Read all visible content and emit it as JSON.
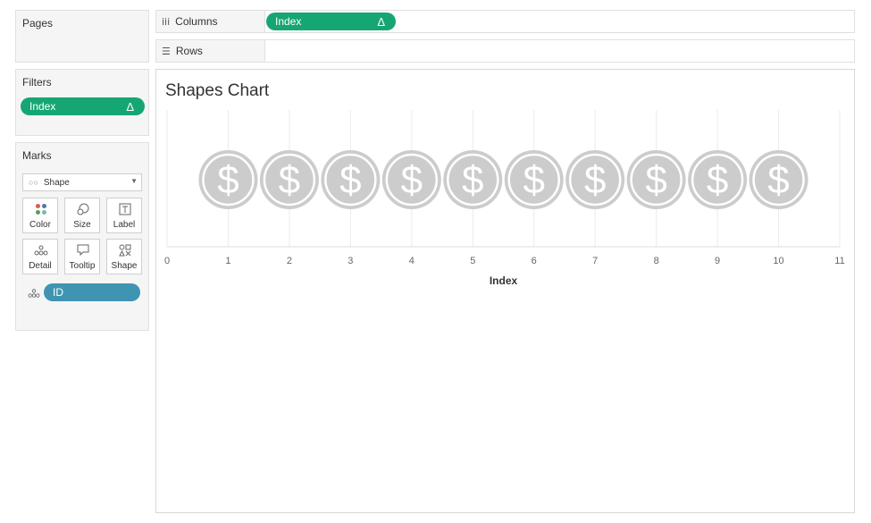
{
  "pages": {
    "title": "Pages"
  },
  "columns": {
    "label": "Columns",
    "pill": "Index",
    "pill_delta": "Δ"
  },
  "rows": {
    "label": "Rows"
  },
  "filters": {
    "title": "Filters",
    "pill": "Index",
    "pill_delta": "Δ"
  },
  "marks": {
    "title": "Marks",
    "mark_type": "Shape",
    "buttons": {
      "color": "Color",
      "size": "Size",
      "label": "Label",
      "detail": "Detail",
      "tooltip": "Tooltip",
      "shape": "Shape"
    },
    "detail_pill": "ID"
  },
  "colors": {
    "green_pill": "#16a673",
    "blue_pill": "#3f94b1",
    "shape_fill": "#cccccc",
    "gridline": "#ebebeb"
  },
  "chart_data": {
    "type": "scatter",
    "title": "Shapes Chart",
    "xlabel": "Index",
    "ylabel": "",
    "x": [
      1,
      2,
      3,
      4,
      5,
      6,
      7,
      8,
      9,
      10
    ],
    "xlim": [
      0,
      11
    ],
    "xticks": [
      0,
      1,
      2,
      3,
      4,
      5,
      6,
      7,
      8,
      9,
      10,
      11
    ],
    "shape": "dollar-coin-icon",
    "shape_symbol": "$",
    "grid": true
  }
}
